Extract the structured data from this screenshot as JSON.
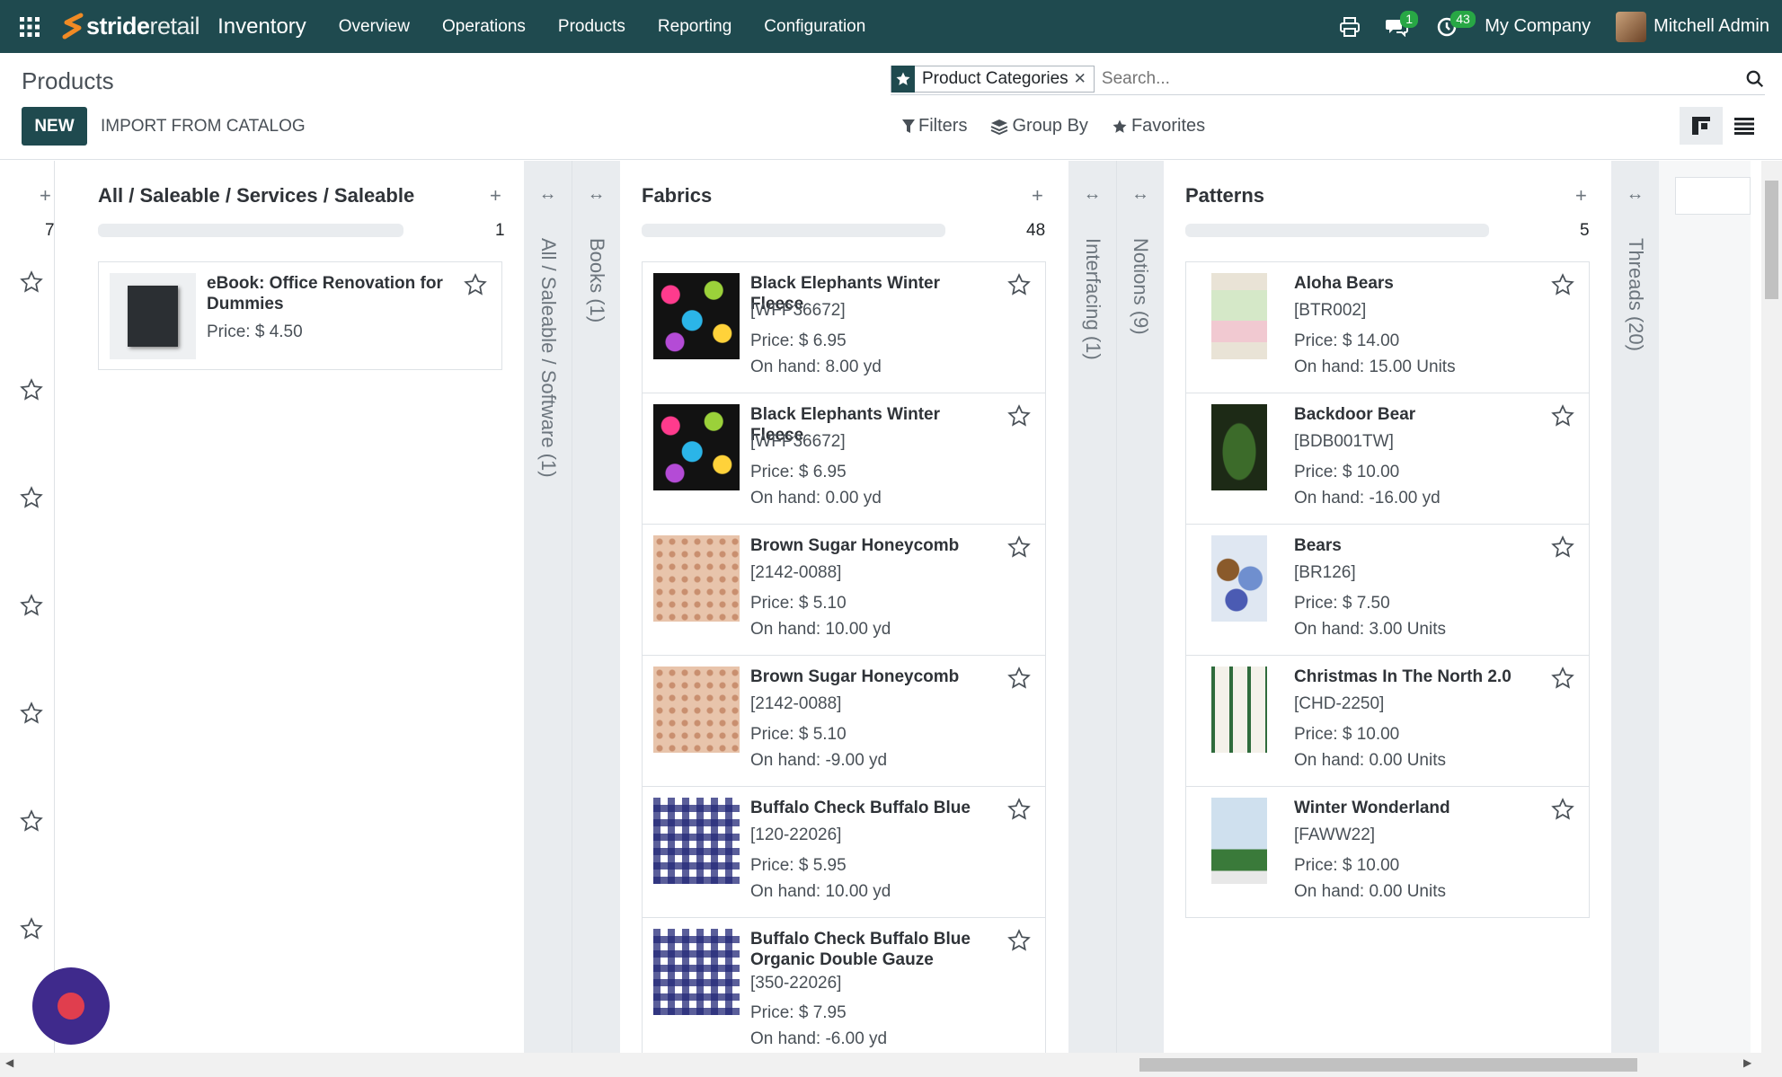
{
  "topbar": {
    "brand_a": "stride",
    "brand_b": "retail",
    "app_name": "Inventory",
    "menu": [
      "Overview",
      "Operations",
      "Products",
      "Reporting",
      "Configuration"
    ],
    "messages_badge": "1",
    "activities_badge": "43",
    "company": "My Company",
    "user": "Mitchell Admin"
  },
  "control_panel": {
    "breadcrumb": "Products",
    "new_label": "NEW",
    "import_label": "IMPORT FROM CATALOG",
    "facet_value": "Product Categories",
    "search_placeholder": "Search...",
    "filters_label": "Filters",
    "groupby_label": "Group By",
    "favorites_label": "Favorites"
  },
  "board": {
    "left_col_count": "7",
    "columns": [
      {
        "title": "All / Saleable / Services / Saleable",
        "count": "1",
        "progress": 1.0,
        "cards": [
          {
            "name": "eBook: Office Renovation for Dummies",
            "ref": "",
            "price": "Price: $ 4.50",
            "onhand": "",
            "image": "ebook"
          }
        ]
      },
      {
        "title": "Fabrics",
        "count": "48",
        "progress": 1.0,
        "cards": [
          {
            "name": "Black Elephants Winter Fleece",
            "ref": "[WFP36672]",
            "price": "Price: $ 6.95",
            "onhand": "On hand: 8.00 yd",
            "image": "elephants"
          },
          {
            "name": "Black Elephants Winter Fleece",
            "ref": "[WFP36672]",
            "price": "Price: $ 6.95",
            "onhand": "On hand: 0.00 yd",
            "image": "elephants"
          },
          {
            "name": "Brown Sugar Honeycomb",
            "ref": "[2142-0088]",
            "price": "Price: $ 5.10",
            "onhand": "On hand: 10.00 yd",
            "image": "honeycomb"
          },
          {
            "name": "Brown Sugar Honeycomb",
            "ref": "[2142-0088]",
            "price": "Price: $ 5.10",
            "onhand": "On hand: -9.00 yd",
            "image": "honeycomb"
          },
          {
            "name": "Buffalo Check Buffalo Blue",
            "ref": "[120-22026]",
            "price": "Price: $ 5.95",
            "onhand": "On hand: 10.00 yd",
            "image": "check"
          },
          {
            "name": "Buffalo Check Buffalo Blue Organic Double Gauze",
            "ref": "[350-22026]",
            "price": "Price: $ 7.95",
            "onhand": "On hand: -6.00 yd",
            "image": "check"
          }
        ]
      },
      {
        "title": "Patterns",
        "count": "5",
        "progress": 1.0,
        "cards": [
          {
            "name": "Aloha Bears",
            "ref": "[BTR002]",
            "price": "Price: $ 14.00",
            "onhand": "On hand: 15.00 Units",
            "image": "pattern1"
          },
          {
            "name": "Backdoor Bear",
            "ref": "[BDB001TW]",
            "price": "Price: $ 10.00",
            "onhand": "On hand: -16.00 yd",
            "image": "pattern2"
          },
          {
            "name": "Bears",
            "ref": "[BR126]",
            "price": "Price: $ 7.50",
            "onhand": "On hand: 3.00 Units",
            "image": "pattern3"
          },
          {
            "name": "Christmas In The North 2.0",
            "ref": "[CHD-2250]",
            "price": "Price: $ 10.00",
            "onhand": "On hand: 0.00 Units",
            "image": "pattern4"
          },
          {
            "name": "Winter Wonderland",
            "ref": "[FAWW22]",
            "price": "Price: $ 10.00",
            "onhand": "On hand: 0.00 Units",
            "image": "pattern5"
          }
        ]
      }
    ],
    "folded": [
      {
        "label": "All / Saleable / Software (1)"
      },
      {
        "label": "Books (1)"
      },
      {
        "label": "Interfacing (1)"
      },
      {
        "label": "Notions (9)"
      },
      {
        "label": "Threads (20)"
      }
    ]
  },
  "colors": {
    "brand": "#1f4a4f",
    "badge": "#28a745",
    "fab": "#3f2a8c"
  }
}
